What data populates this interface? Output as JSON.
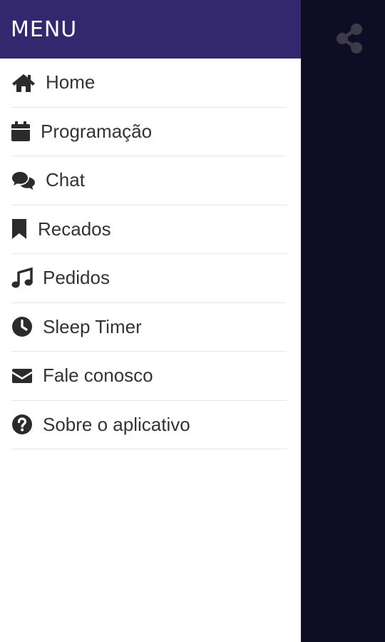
{
  "header": {
    "title": "MENU"
  },
  "share": {
    "icon": "share-icon"
  },
  "colors": {
    "header_bg": "#332770",
    "backdrop": "#0f0d24",
    "icon": "#2b2b2b",
    "text": "#333333"
  },
  "menu": {
    "items": [
      {
        "label": "Home",
        "icon": "home-icon"
      },
      {
        "label": "Programação",
        "icon": "calendar-icon"
      },
      {
        "label": "Chat",
        "icon": "chat-icon"
      },
      {
        "label": "Recados",
        "icon": "bookmark-icon"
      },
      {
        "label": "Pedidos",
        "icon": "music-note-icon"
      },
      {
        "label": "Sleep Timer",
        "icon": "clock-icon"
      },
      {
        "label": "Fale conosco",
        "icon": "envelope-icon"
      },
      {
        "label": "Sobre o aplicativo",
        "icon": "help-icon"
      }
    ]
  }
}
